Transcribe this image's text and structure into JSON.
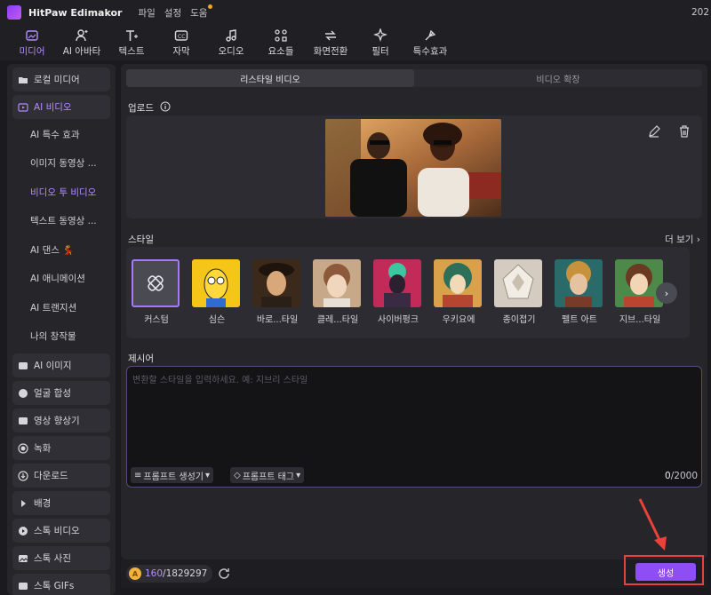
{
  "app": {
    "name": "HitPaw Edimakor",
    "menu": [
      "파일",
      "설정",
      "도움"
    ],
    "title_right": "202",
    "brand_color": "#8f4df5"
  },
  "toolbar": [
    {
      "label": "미디어",
      "icon": "media-icon",
      "active": true
    },
    {
      "label": "AI 아바타",
      "icon": "avatar-icon"
    },
    {
      "label": "텍스트",
      "icon": "text-icon"
    },
    {
      "label": "자막",
      "icon": "caption-icon"
    },
    {
      "label": "오디오",
      "icon": "music-icon"
    },
    {
      "label": "요소들",
      "icon": "elements-icon"
    },
    {
      "label": "화면전환",
      "icon": "transition-icon"
    },
    {
      "label": "필터",
      "icon": "filter-icon"
    },
    {
      "label": "특수효과",
      "icon": "effects-icon"
    }
  ],
  "sidebar": {
    "local_media": "로컬 미디어",
    "ai_video": "AI 비디오",
    "sub": [
      "AI 특수 효과",
      "이미지 동영상 ...",
      "비디오 투 비디오",
      "텍스트 동영상 ...",
      "AI 댄스 💃",
      "AI 애니메이션",
      "AI 트랜지션",
      "나의 창작물"
    ],
    "rest": [
      "AI 이미지",
      "얼굴 합성",
      "영상 향상기",
      "녹화",
      "다운로드",
      "배경",
      "스톡 비디오",
      "스톡 사진",
      "스톡 GIFs"
    ]
  },
  "main": {
    "tabs": [
      "리스타일 비디오",
      "비디오 확장"
    ],
    "upload_label": "업로드",
    "style_label": "스타일",
    "more_label": "더 보기",
    "styles": [
      "커스텀",
      "심슨",
      "바로...타일",
      "클레...타일",
      "사이버펑크",
      "우키요에",
      "종이접기",
      "펠트 아트",
      "지브...타일"
    ],
    "prompt_label": "제시어",
    "prompt_placeholder": "변환할 스타일을 입력하세요. 예: 지브리 스타일",
    "prompt_generator": "프롬프트 생성기",
    "prompt_tags": "프롬프트 태그",
    "counter_current": "0",
    "counter_max": "/2000"
  },
  "bottom": {
    "credits_used": "160",
    "credits_total": "/1829297",
    "generate_label": "생성"
  }
}
